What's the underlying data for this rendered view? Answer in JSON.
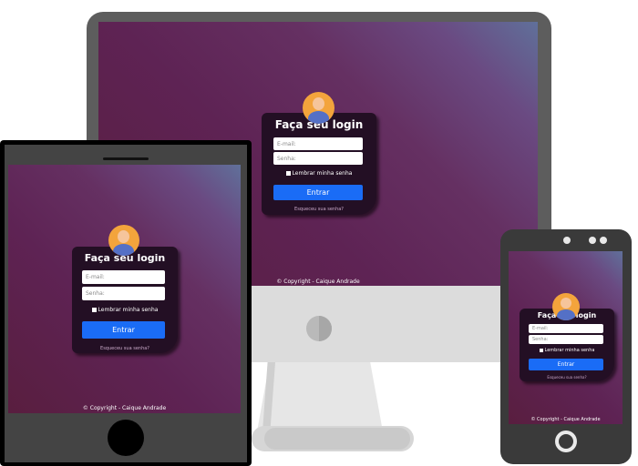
{
  "login": {
    "title": "Faça seu login",
    "email_placeholder": "E-mail:",
    "password_placeholder": "Senha:",
    "remember_label": "Lembrar minha senha",
    "submit_label": "Entrar",
    "forgot_label": "Esqueceu sua senha?"
  },
  "footer": {
    "copyright": "© Copyright - Caique Andrade"
  },
  "colors": {
    "card_background": "#230f24",
    "button": "#1a6cf6",
    "avatar": "#f3a43c"
  },
  "icons": {
    "avatar": "user-avatar-icon"
  }
}
